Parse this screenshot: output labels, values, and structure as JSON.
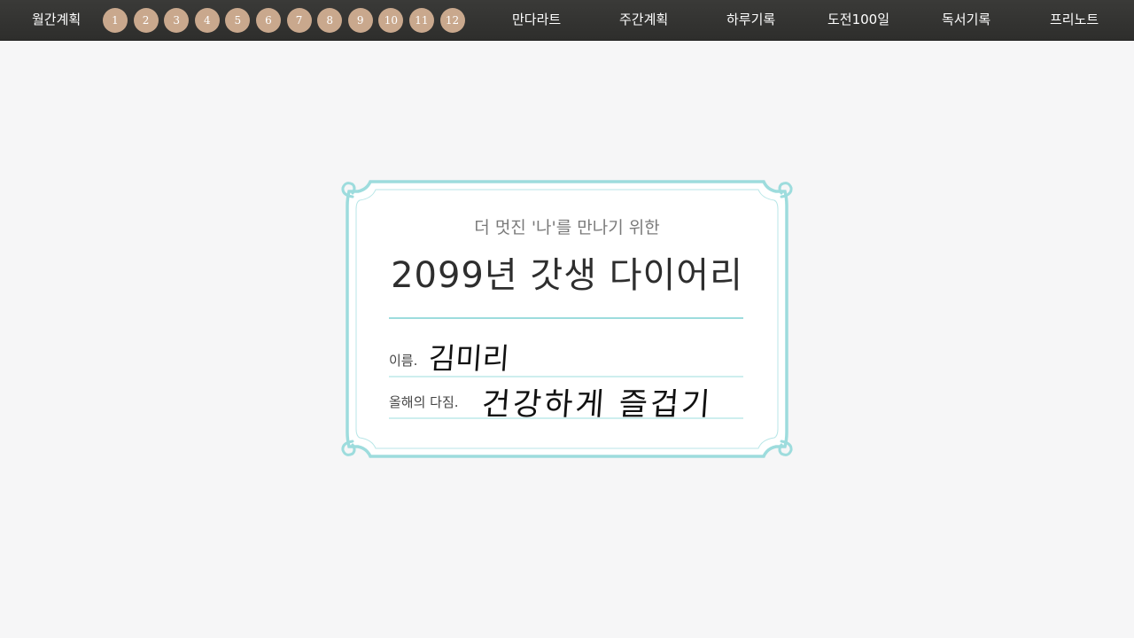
{
  "nav": {
    "monthly": "월간계획",
    "months": [
      "1",
      "2",
      "3",
      "4",
      "5",
      "6",
      "7",
      "8",
      "9",
      "10",
      "11",
      "12"
    ],
    "items": [
      "만다라트",
      "주간계획",
      "하루기록",
      "도전100일",
      "독서기록",
      "프리노트"
    ]
  },
  "card": {
    "subtitle": "더 멋진 '나'를 만나기 위한",
    "title": "2099년 갓생 다이어리",
    "name_label": "이름.",
    "name_value": "김미리",
    "resolution_label": "올해의 다짐.",
    "resolution_value": "건강하게 즐겁기"
  },
  "colors": {
    "topbar": "#333331",
    "month_button": "#c9a88d",
    "frame": "#9ddcdd",
    "background": "#f6f6f7"
  }
}
